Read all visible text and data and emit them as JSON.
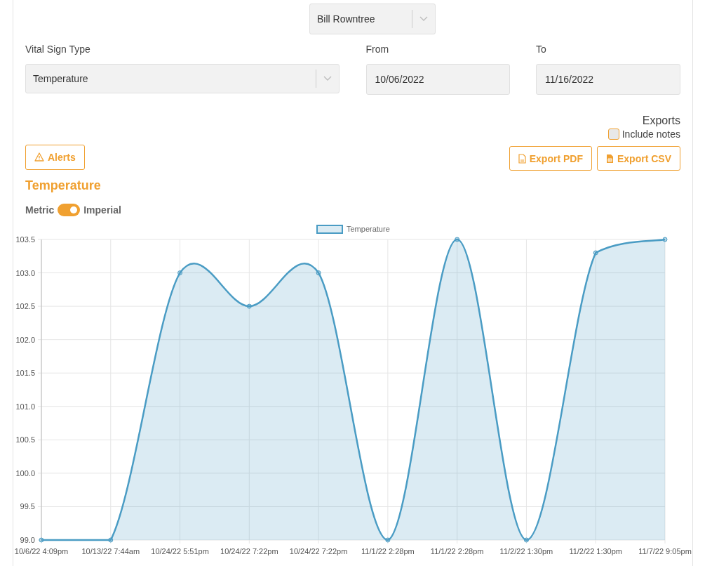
{
  "patient_select": {
    "value": "Bill Rowntree"
  },
  "filters": [
    {
      "label": "Vital Sign Type",
      "value": "Temperature",
      "kind": "select"
    },
    {
      "label": "From",
      "value": "10/06/2022",
      "kind": "date"
    },
    {
      "label": "To",
      "value": "11/16/2022",
      "kind": "date"
    }
  ],
  "exports": {
    "title": "Exports",
    "include_notes": {
      "label": "Include notes",
      "checked": false
    },
    "buttons": [
      {
        "label": "Export PDF",
        "kind": "pdf"
      },
      {
        "label": "Export CSV",
        "kind": "csv"
      }
    ]
  },
  "alerts_button": {
    "label": "Alerts"
  },
  "section_title": "Temperature",
  "unit_toggle": {
    "left": "Metric",
    "right": "Imperial",
    "on": true
  },
  "chart_data": {
    "type": "area",
    "categories": [
      "10/6/22 4:09pm",
      "10/13/22 7:44am",
      "10/24/22 5:51pm",
      "10/24/22 7:22pm",
      "10/24/22 7:22pm",
      "11/1/22 2:28pm",
      "11/1/22 2:28pm",
      "11/2/22 1:30pm",
      "11/2/22 1:30pm",
      "11/7/22 9:05pm"
    ],
    "series": [
      {
        "name": "Temperature",
        "color": "#4a9cc4",
        "values": [
          99.0,
          99.0,
          103.0,
          102.5,
          103.0,
          99.0,
          103.5,
          99.0,
          103.3,
          103.5
        ]
      }
    ],
    "ylim": [
      99.0,
      103.5
    ],
    "grid": true,
    "yticks": [
      {
        "value": 99,
        "label": "99.0"
      },
      {
        "value": 99.5,
        "label": "99.5"
      },
      {
        "value": 100,
        "label": "100.0"
      },
      {
        "value": 100.5,
        "label": "100.5"
      },
      {
        "value": 101,
        "label": "101.0"
      },
      {
        "value": 101.5,
        "label": "101.5"
      },
      {
        "value": 102,
        "label": "102.0"
      },
      {
        "value": 102.5,
        "label": "102.5"
      },
      {
        "value": 103,
        "label": "103.0"
      },
      {
        "value": 103.5,
        "label": "103.5"
      }
    ]
  }
}
